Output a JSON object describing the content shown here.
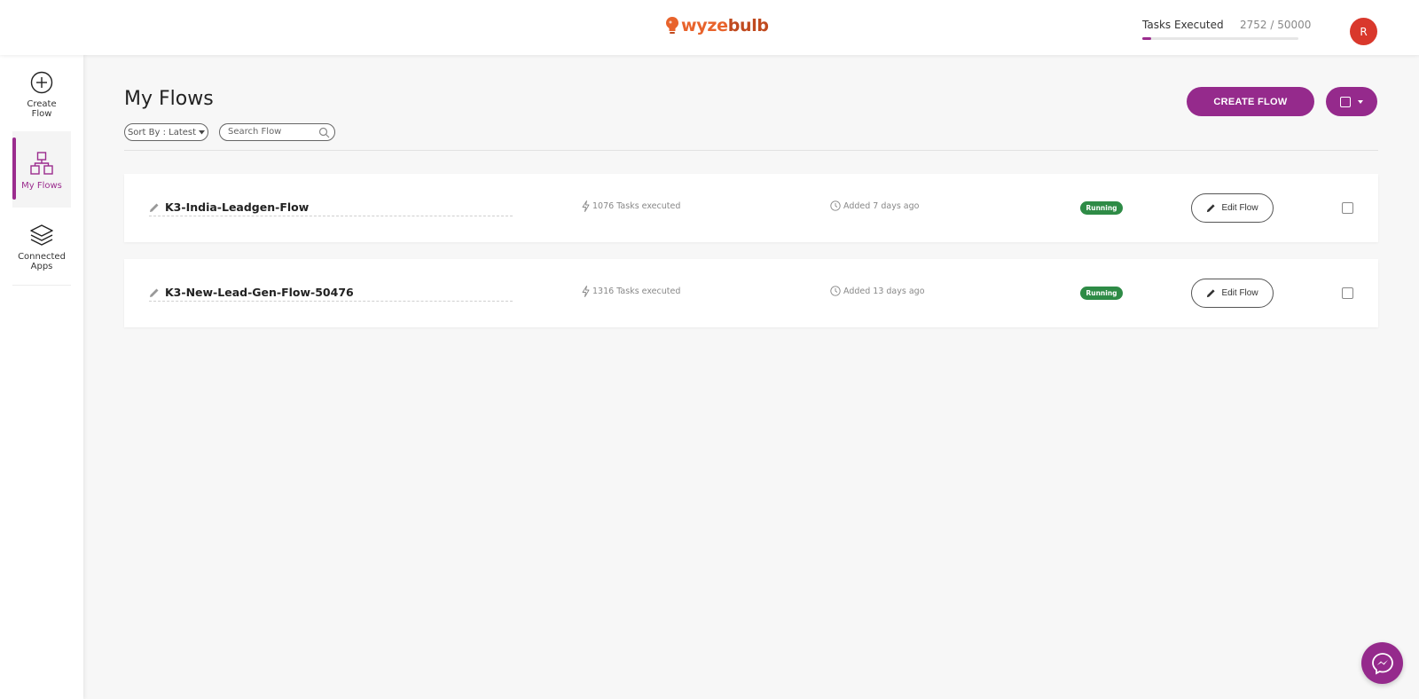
{
  "header": {
    "logo": {
      "part1": "wyze",
      "part2": "bulb"
    },
    "tasks_label": "Tasks Executed",
    "tasks_count": "2752 / 50000",
    "tasks_progress": 0.055,
    "avatar_initial": "R"
  },
  "sidebar": {
    "items": [
      {
        "label": "Create Flow",
        "icon": "plus-circle-icon",
        "active": false
      },
      {
        "label": "My Flows",
        "icon": "flows-icon",
        "active": true
      },
      {
        "label": "Connected Apps",
        "icon": "layers-icon",
        "active": false
      }
    ]
  },
  "main": {
    "title": "My Flows",
    "sort_label": "Sort By : Latest",
    "search_placeholder": "Search Flow",
    "create_flow_label": "CREATE FLOW"
  },
  "flows": [
    {
      "name": "K3-India-Leadgen-Flow",
      "tasks": "1076 Tasks executed",
      "added": "Added 7 days ago",
      "status": "Running",
      "edit_label": "Edit Flow"
    },
    {
      "name": "K3-New-Lead-Gen-Flow-50476",
      "tasks": "1316 Tasks executed",
      "added": "Added 13 days ago",
      "status": "Running",
      "edit_label": "Edit Flow"
    }
  ],
  "colors": {
    "primary": "#952a8c",
    "running": "#2e8b46",
    "avatar": "#d9382c",
    "logo": "#e8632c"
  }
}
